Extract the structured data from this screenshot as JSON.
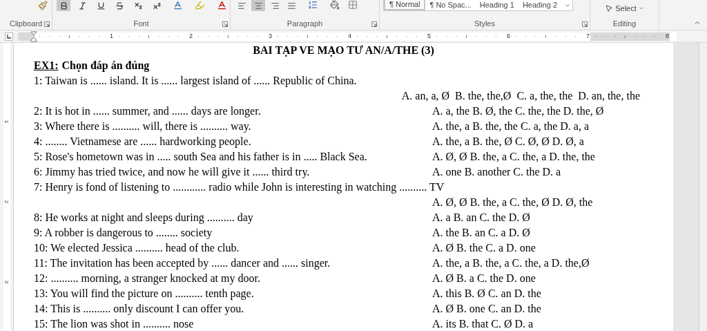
{
  "ribbon": {
    "groups": [
      {
        "label": "Clipboard"
      },
      {
        "label": "Font"
      },
      {
        "label": "Paragraph"
      },
      {
        "label": "Styles"
      },
      {
        "label": "Editing"
      }
    ],
    "font_buttons": [
      {
        "kind": "bold",
        "selected": true
      },
      {
        "kind": "italic",
        "selected": false
      },
      {
        "kind": "underline",
        "selected": false
      },
      {
        "kind": "strikethrough",
        "selected": false
      },
      {
        "kind": "subscript",
        "selected": false
      },
      {
        "kind": "superscript",
        "selected": false
      }
    ],
    "alignment": [
      {
        "kind": "left",
        "selected": false
      },
      {
        "kind": "center",
        "selected": true
      },
      {
        "kind": "right",
        "selected": false
      },
      {
        "kind": "justify",
        "selected": false
      }
    ],
    "styles": [
      {
        "label": "¶ Normal",
        "selected": true
      },
      {
        "label": "¶ No Spac...",
        "selected": false
      },
      {
        "label": "Heading 1",
        "selected": false
      },
      {
        "label": "Heading 2",
        "selected": false
      }
    ],
    "select_button": "Select"
  },
  "ruler": {
    "labels": [
      "1",
      "2",
      "3",
      "4",
      "5",
      "6",
      "7",
      "8"
    ]
  },
  "vertical_ruler": {
    "labels": [
      "1",
      "2",
      "3"
    ]
  },
  "document": {
    "title": "BAI TẠP VE MẠO TƯ AN/A/THE (3)",
    "heading": {
      "label": "EX1:",
      "text": "Chọn đáp án đúng"
    },
    "questions": [
      {
        "kind": "wrap_right",
        "question": "1: Taiwan is ...... island. It is ...... largest island of ...... Republic of China.",
        "answers": "A. an, a, Ø  B. the, the,Ø  C. a, the, the  D. an, the, the"
      },
      {
        "kind": "inline",
        "question": "2: It is hot in ...... summer, and ...... days are longer.",
        "answers": "A. a, the B. Ø, the C. the, the D. the, Ø"
      },
      {
        "kind": "inline",
        "question": "3: Where there is .......... will, there is .......... way.",
        "answers": "A. the, a B. the, the C. a, the D. a, a"
      },
      {
        "kind": "inline",
        "question": "4: ........ Vietnamese are ...... hardworking people.",
        "answers": "A. the, a B. the, Ø C. Ø, Ø D. Ø, a"
      },
      {
        "kind": "inline",
        "question": "5: Rose's hometown was in ..... south Sea and his father is in ..... Black Sea.",
        "answers": "A. Ø, Ø B. the, a C. the, a D. the, the"
      },
      {
        "kind": "inline",
        "question": "6: Jimmy has tried twice, and now he will give it ...... third try.",
        "answers": "A. one B. another C. the D. a"
      },
      {
        "kind": "wrap",
        "question": "7: Henry is fond of listening to ............ radio while John is interesting in watching .......... TV",
        "answers": "A. Ø, Ø B. the, a C. the, Ø D. Ø, the"
      },
      {
        "kind": "inline",
        "question": "8: He works at night and sleeps during .......... day",
        "answers": "A. a B. an C. the D. Ø"
      },
      {
        "kind": "inline",
        "question": "9: A robber is dangerous to ........ society",
        "answers": "A. the B. an C. a D. Ø"
      },
      {
        "kind": "inline",
        "question": "10: We elected Jessica .......... head of the club.",
        "answers": "A. Ø B. the C. a D. one"
      },
      {
        "kind": "inline",
        "question": "11: The invitation has been accepted by ...... dancer and ...... singer.",
        "answers": "A. the, a B. the, a C. the, a D. the,Ø"
      },
      {
        "kind": "inline",
        "question": "12: .......... morning, a stranger knocked at my door.",
        "answers": "A. Ø B. a C. the D. one"
      },
      {
        "kind": "inline",
        "question": "13: You will find the picture on .......... tenth page.",
        "answers": "A. this B. Ø C. an D. the"
      },
      {
        "kind": "inline",
        "question": "14: This is .......... only discount I can offer you.",
        "answers": "A. Ø B. one C. an D. the"
      },
      {
        "kind": "inline",
        "question": "15: The lion was shot in .......... nose",
        "answers": "A. its B. that C. Ø D. a"
      }
    ]
  }
}
